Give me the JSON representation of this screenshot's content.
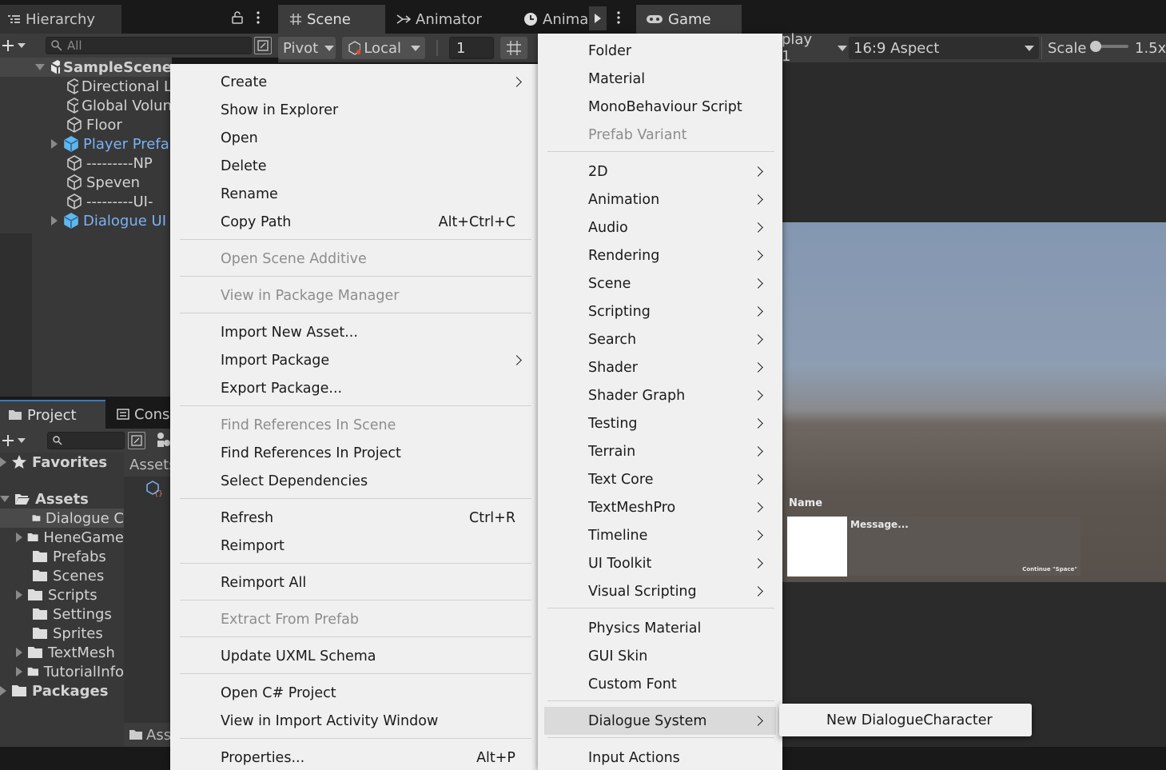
{
  "tabs": {
    "hierarchy": "Hierarchy",
    "scene": "Scene",
    "animator": "Animator",
    "animation": "Anima",
    "game": "Game"
  },
  "hierarchy": {
    "search_placeholder": "All",
    "scene_name": "SampleScene",
    "items": [
      {
        "label": "Directional L",
        "prefab": false
      },
      {
        "label": "Global Volun",
        "prefab": false
      },
      {
        "label": "Floor",
        "prefab": false
      },
      {
        "label": "Player Prefa",
        "prefab": true
      },
      {
        "label": "---------NP",
        "prefab": false
      },
      {
        "label": "Speven",
        "prefab": false
      },
      {
        "label": "---------UI-",
        "prefab": false
      },
      {
        "label": "Dialogue UI",
        "prefab": true
      }
    ]
  },
  "scene_toolbar": {
    "pivot": "Pivot",
    "local": "Local",
    "grid_value": "1"
  },
  "game_toolbar": {
    "display": "play 1",
    "aspect": "16:9 Aspect",
    "scale_label": "Scale",
    "scale_value": "1.5x"
  },
  "game_view": {
    "dialogue_name": "Name",
    "dialogue_message": "Message...",
    "dialogue_hint": "Continue \"Space\""
  },
  "project": {
    "tab_project": "Project",
    "tab_console": "Cons",
    "breadcrumb": "Assets",
    "bottom_path": "Ass",
    "favorites": "Favorites",
    "assets": "Assets",
    "packages": "Packages",
    "folders": [
      {
        "label": "Dialogue C",
        "expandable": false,
        "selected": true
      },
      {
        "label": "HeneGame",
        "expandable": true,
        "selected": false
      },
      {
        "label": "Prefabs",
        "expandable": false,
        "selected": false
      },
      {
        "label": "Scenes",
        "expandable": false,
        "selected": false
      },
      {
        "label": "Scripts",
        "expandable": true,
        "selected": false
      },
      {
        "label": "Settings",
        "expandable": false,
        "selected": false
      },
      {
        "label": "Sprites",
        "expandable": false,
        "selected": false
      },
      {
        "label": "TextMesh",
        "expandable": true,
        "selected": false
      },
      {
        "label": "TutorialInfo",
        "expandable": true,
        "selected": false
      }
    ]
  },
  "context_menu": {
    "items": [
      {
        "label": "Create",
        "submenu": true
      },
      {
        "label": "Show in Explorer"
      },
      {
        "label": "Open"
      },
      {
        "label": "Delete"
      },
      {
        "label": "Rename"
      },
      {
        "label": "Copy Path",
        "shortcut": "Alt+Ctrl+C"
      },
      {
        "label": "Open Scene Additive",
        "disabled": true
      },
      {
        "label": "View in Package Manager",
        "disabled": true
      },
      {
        "label": "Import New Asset..."
      },
      {
        "label": "Import Package",
        "submenu": true
      },
      {
        "label": "Export Package..."
      },
      {
        "label": "Find References In Scene",
        "disabled": true
      },
      {
        "label": "Find References In Project"
      },
      {
        "label": "Select Dependencies"
      },
      {
        "label": "Refresh",
        "shortcut": "Ctrl+R"
      },
      {
        "label": "Reimport"
      },
      {
        "label": "Reimport All"
      },
      {
        "label": "Extract From Prefab",
        "disabled": true
      },
      {
        "label": "Update UXML Schema"
      },
      {
        "label": "Open C# Project"
      },
      {
        "label": "View in Import Activity Window"
      },
      {
        "label": "Properties...",
        "shortcut": "Alt+P"
      }
    ]
  },
  "create_menu": {
    "items": [
      {
        "label": "Folder"
      },
      {
        "label": "Material"
      },
      {
        "label": "MonoBehaviour Script"
      },
      {
        "label": "Prefab Variant",
        "disabled": true
      },
      {
        "label": "2D",
        "submenu": true
      },
      {
        "label": "Animation",
        "submenu": true
      },
      {
        "label": "Audio",
        "submenu": true
      },
      {
        "label": "Rendering",
        "submenu": true
      },
      {
        "label": "Scene",
        "submenu": true
      },
      {
        "label": "Scripting",
        "submenu": true
      },
      {
        "label": "Search",
        "submenu": true
      },
      {
        "label": "Shader",
        "submenu": true
      },
      {
        "label": "Shader Graph",
        "submenu": true
      },
      {
        "label": "Testing",
        "submenu": true
      },
      {
        "label": "Terrain",
        "submenu": true
      },
      {
        "label": "Text Core",
        "submenu": true
      },
      {
        "label": "TextMeshPro",
        "submenu": true
      },
      {
        "label": "Timeline",
        "submenu": true
      },
      {
        "label": "UI Toolkit",
        "submenu": true
      },
      {
        "label": "Visual Scripting",
        "submenu": true
      },
      {
        "label": "Physics Material"
      },
      {
        "label": "GUI Skin"
      },
      {
        "label": "Custom Font"
      },
      {
        "label": "Dialogue System",
        "submenu": true,
        "highlighted": true
      },
      {
        "label": "Input Actions"
      }
    ]
  },
  "dialogue_submenu": {
    "items": [
      {
        "label": "New DialogueCharacter"
      }
    ]
  }
}
